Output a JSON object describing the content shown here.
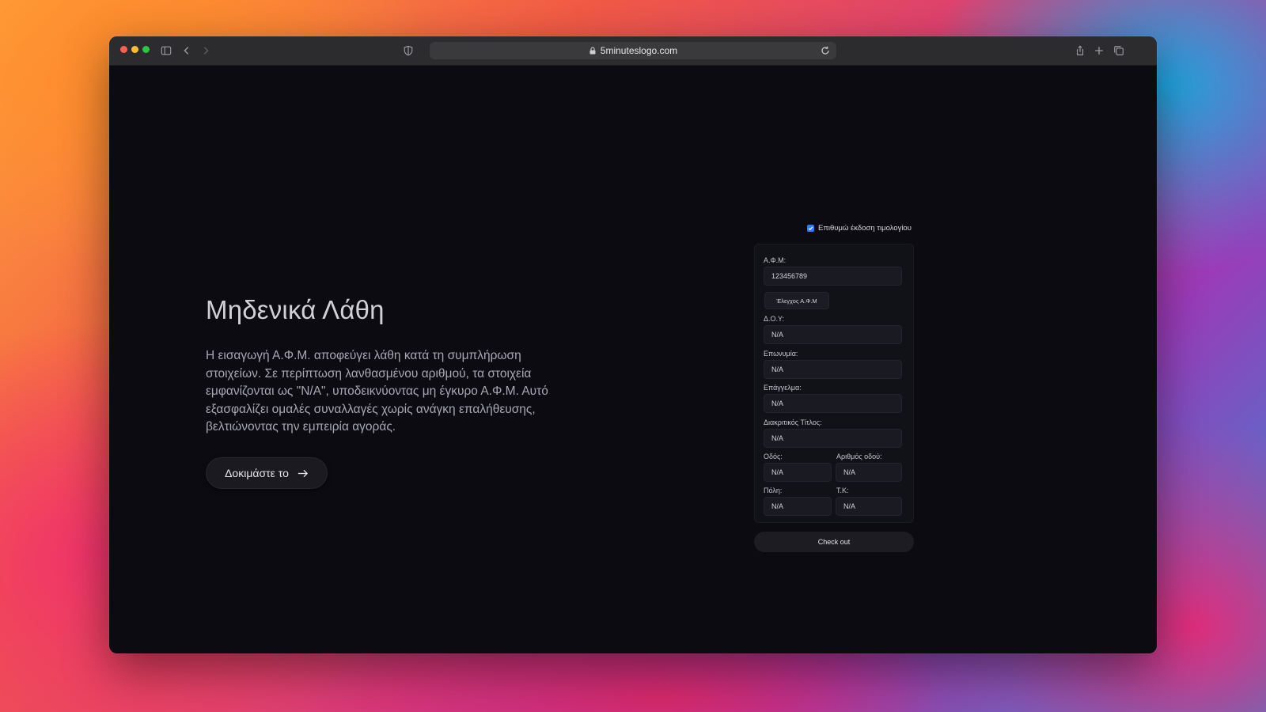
{
  "browser": {
    "url": "5minuteslogo.com"
  },
  "hero": {
    "title": "Μηδενικά Λάθη",
    "description": "Η εισαγωγή Α.Φ.Μ. αποφεύγει λάθη κατά τη συμπλήρωση στοιχείων. Σε περίπτωση λανθασμένου αριθμού, τα στοιχεία εμφανίζονται ως \"N/A\", υποδεικνύοντας μη έγκυρο Α.Φ.Μ. Αυτό εξασφαλίζει ομαλές συναλλαγές χωρίς ανάγκη επαλήθευσης, βελτιώνοντας την εμπειρία αγοράς.",
    "cta_label": "Δοκιμάστε το"
  },
  "invoice": {
    "checkbox_label": "Επιθυμώ έκδοση τιμολογίου",
    "checked": true
  },
  "form": {
    "afm_label": "Α.Φ.Μ:",
    "afm_value": "123456789",
    "verify_label": "Έλεγχος Α.Φ.Μ",
    "doy_label": "Δ.Ο.Υ:",
    "doy_value": "N/A",
    "name_label": "Επωνυμία:",
    "name_value": "N/A",
    "profession_label": "Επάγγελμα:",
    "profession_value": "N/A",
    "title_label": "Διακριτικός Τίτλος:",
    "title_value": "N/A",
    "street_label": "Οδός:",
    "street_value": "N/A",
    "street_no_label": "Αριθμός οδού:",
    "street_no_value": "N/A",
    "city_label": "Πόλη:",
    "city_value": "N/A",
    "zip_label": "Τ.Κ:",
    "zip_value": "N/A"
  },
  "checkout_label": "Check out",
  "colors": {
    "accent": "#2f7df6",
    "page_bg": "#0b0b11"
  }
}
